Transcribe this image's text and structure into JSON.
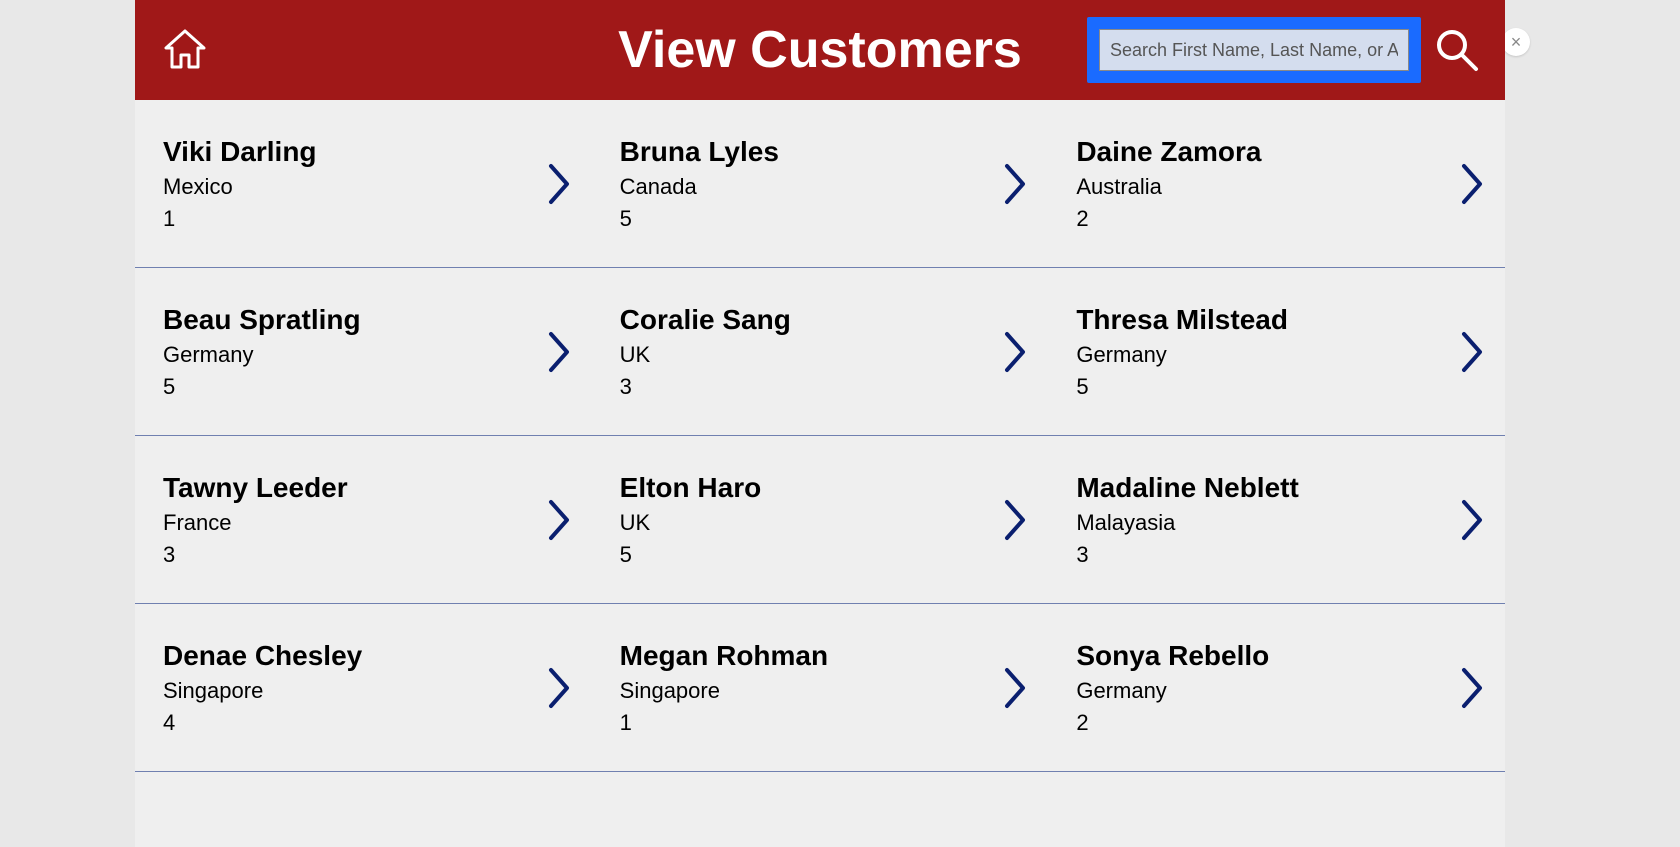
{
  "header": {
    "title": "View Customers",
    "search_placeholder": "Search First Name, Last Name, or Age",
    "search_value": ""
  },
  "close_label": "×",
  "customers": [
    {
      "first": "Viki",
      "last": "Darling",
      "country": "Mexico",
      "num": "1"
    },
    {
      "first": "Bruna",
      "last": "Lyles",
      "country": "Canada",
      "num": "5"
    },
    {
      "first": "Daine",
      "last": "Zamora",
      "country": "Australia",
      "num": "2"
    },
    {
      "first": "Beau",
      "last": "Spratling",
      "country": "Germany",
      "num": "5"
    },
    {
      "first": "Coralie",
      "last": "Sang",
      "country": "UK",
      "num": "3"
    },
    {
      "first": "Thresa",
      "last": "Milstead",
      "country": "Germany",
      "num": "5"
    },
    {
      "first": "Tawny",
      "last": "Leeder",
      "country": "France",
      "num": "3"
    },
    {
      "first": "Elton",
      "last": "Haro",
      "country": "UK",
      "num": "5"
    },
    {
      "first": "Madaline",
      "last": "Neblett",
      "country": "Malayasia",
      "num": "3"
    },
    {
      "first": "Denae",
      "last": "Chesley",
      "country": "Singapore",
      "num": "4"
    },
    {
      "first": "Megan",
      "last": "Rohman",
      "country": "Singapore",
      "num": "1"
    },
    {
      "first": "Sonya",
      "last": "Rebello",
      "country": "Germany",
      "num": "2"
    }
  ]
}
